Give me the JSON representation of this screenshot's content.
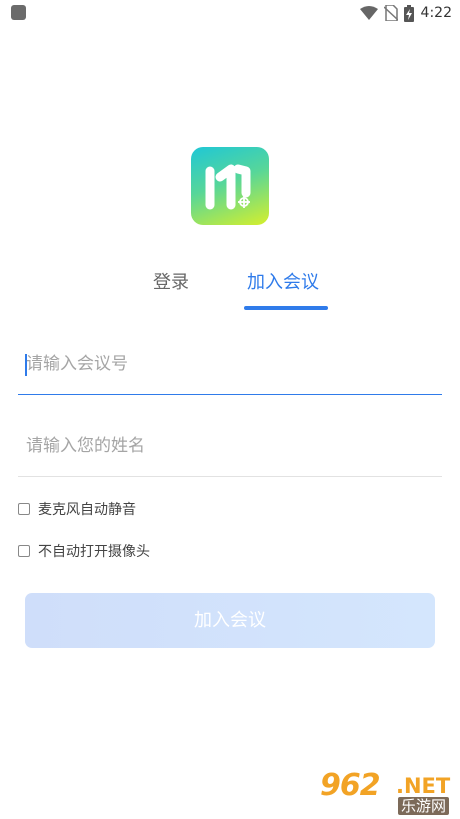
{
  "status_bar": {
    "time": "4:22",
    "icons": [
      "wifi-icon",
      "no-sim-icon",
      "battery-charging-icon"
    ]
  },
  "tabs": [
    {
      "label": "登录",
      "active": false
    },
    {
      "label": "加入会议",
      "active": true
    }
  ],
  "form": {
    "meeting_id": {
      "placeholder": "请输入会议号",
      "value": ""
    },
    "name": {
      "placeholder": "请输入您的姓名",
      "value": ""
    },
    "options": [
      {
        "label": "麦克风自动静音",
        "checked": false
      },
      {
        "label": "不自动打开摄像头",
        "checked": false
      }
    ],
    "join_button": "加入会议"
  },
  "watermark": {
    "number": "962",
    "suffix": ".NET",
    "subtitle": "乐游网"
  },
  "colors": {
    "accent": "#2f7bea",
    "button_disabled": "#d2e3fc",
    "watermark": "#f2a325"
  }
}
